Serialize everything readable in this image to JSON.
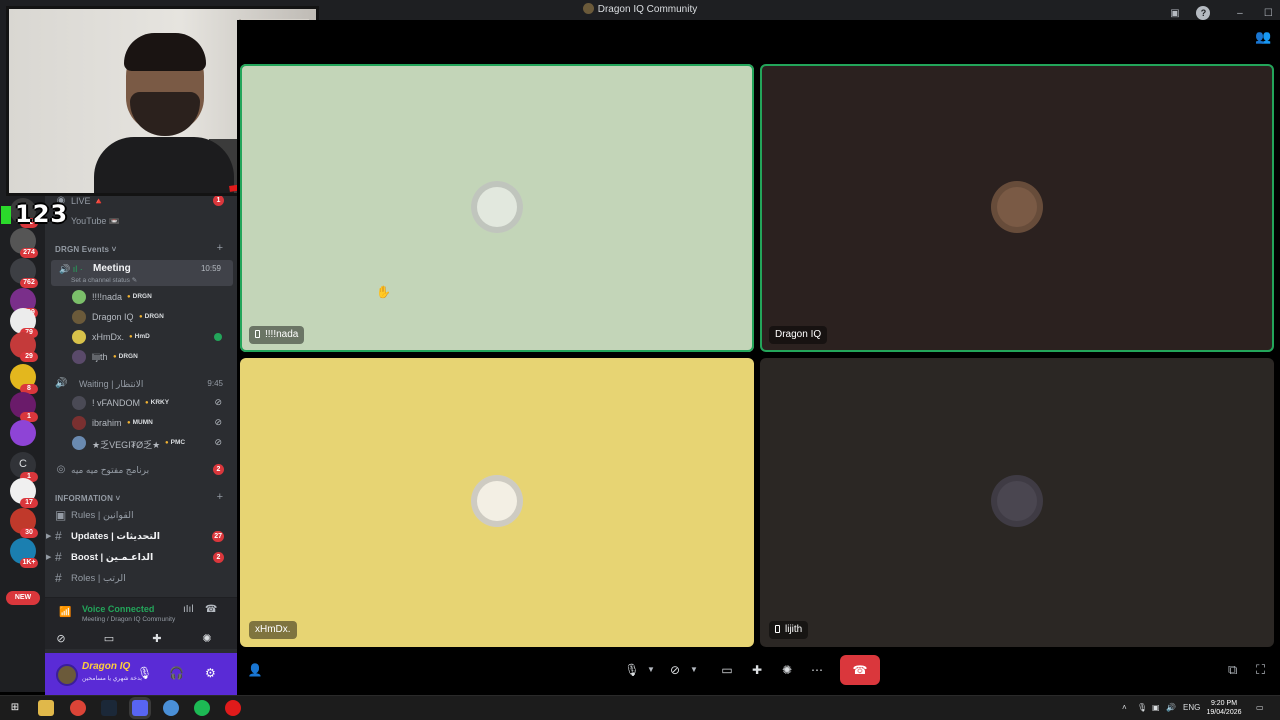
{
  "window": {
    "title": "Dragon IQ Community",
    "controls": {
      "minimize": "–",
      "maximize": "☐",
      "close": "✕"
    }
  },
  "rail": {
    "servers": [
      {
        "name": "server-1",
        "badge": "82",
        "color": "#3b3b3b"
      },
      {
        "name": "server-2",
        "badge": "274",
        "color": "#555"
      },
      {
        "name": "server-3",
        "badge": "762",
        "color": "#3d3f44"
      },
      {
        "name": "server-4",
        "badge": "199",
        "color": "#7a2f8a"
      },
      {
        "name": "server-5",
        "badge": "79",
        "color": "#ececec"
      },
      {
        "name": "server-6",
        "badge": "29",
        "color": "#c43a3a"
      },
      {
        "name": "server-7",
        "badge": "8",
        "color": "#e3b71e"
      },
      {
        "name": "server-8",
        "badge": "1",
        "color": "#6a1b6a"
      },
      {
        "name": "server-9",
        "badge": "",
        "color": "#8e44d6"
      },
      {
        "name": "server-10",
        "badge": "1",
        "color": "#313338",
        "letter": "C"
      },
      {
        "name": "server-11",
        "badge": "17",
        "color": "#f0f0f0"
      },
      {
        "name": "server-12",
        "badge": "30",
        "color": "#c0392b"
      },
      {
        "name": "server-13",
        "badge": "1K+",
        "color": "#1b7fb0"
      }
    ],
    "new_label": "NEW"
  },
  "overlay": {
    "counter": "123"
  },
  "sidebar": {
    "top_rows": [
      {
        "label": "LIVE 🔺",
        "badge": "1"
      },
      {
        "label": "YouTube 📼",
        "badge": ""
      }
    ],
    "events_category": "DRGN Events",
    "meeting": {
      "name": "Meeting",
      "timer": "10:59",
      "status": "Set a channel status ✎"
    },
    "meeting_users": [
      {
        "name": "!!!!nada",
        "tag": "DRGN",
        "color": "#7bbf6a"
      },
      {
        "name": "Dragon IQ",
        "tag": "DRGN",
        "color": "#6b5a3a"
      },
      {
        "name": "xHmDx.",
        "tag": "HmD",
        "color": "#d8c24a"
      },
      {
        "name": "lijith",
        "tag": "DRGN",
        "color": "#5a4a6a"
      }
    ],
    "waiting": {
      "name": "Waiting | الانتظار",
      "timer": "9:45"
    },
    "waiting_users": [
      {
        "name": "! vFANDOM",
        "tag": "KRKY",
        "color": "#4a4a55"
      },
      {
        "name": "ibrahim",
        "tag": "MUMN",
        "color": "#7a3030"
      },
      {
        "name": "★乏VEGI₮Ø乏★",
        "tag": "PMC",
        "color": "#6a8ab0"
      }
    ],
    "stage_channel": {
      "label": "برنامج مفتوح ميه ميه",
      "badge": "2"
    },
    "info_category": "INFORMATION",
    "text_channels": [
      {
        "label": "Rules | القوانين",
        "badge": "",
        "bright": false
      },
      {
        "label": "Updates | التحديثات",
        "badge": "27",
        "bright": true
      },
      {
        "label": "Boost | الداعـمـين",
        "badge": "2",
        "bright": true
      },
      {
        "label": "Roles | الرتب",
        "badge": "",
        "bright": false
      }
    ],
    "voice_panel": {
      "title": "Voice Connected",
      "subtitle": "Meeting / Dragon IQ Community"
    },
    "user": {
      "name": "Dragon IQ",
      "status": "بدخة شهري يا مسامحين"
    }
  },
  "tiles": [
    {
      "name": "!!!!nada",
      "bg": "#c3d5b8",
      "speaking": true,
      "avatar": "#e2e8de",
      "device": true
    },
    {
      "name": "Dragon IQ",
      "bg": "#2b211f",
      "speaking": true,
      "avatar": "#7a5a45",
      "device": false
    },
    {
      "name": "xHmDx.",
      "bg": "#e7d473",
      "speaking": false,
      "avatar": "#f3efe4",
      "device": false
    },
    {
      "name": "lijith",
      "bg": "#2b2724",
      "speaking": false,
      "avatar": "#4a4650",
      "device": true
    }
  ],
  "taskbar": {
    "lang": "ENG",
    "time": "9:20 PM",
    "date": "19/04/2026"
  }
}
